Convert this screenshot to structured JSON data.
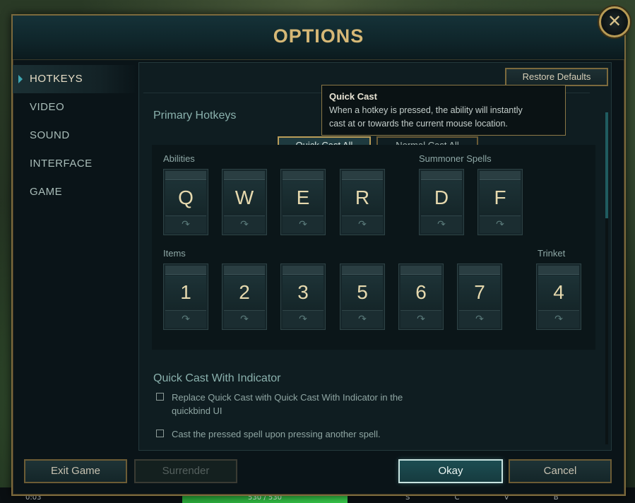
{
  "window": {
    "title": "OPTIONS"
  },
  "sidebar": {
    "items": [
      {
        "label": "HOTKEYS",
        "active": true
      },
      {
        "label": "VIDEO"
      },
      {
        "label": "SOUND"
      },
      {
        "label": "INTERFACE"
      },
      {
        "label": "GAME"
      }
    ]
  },
  "toolbar": {
    "restore_label": "Restore Defaults"
  },
  "primary": {
    "title": "Primary Hotkeys",
    "quick_cast_all": "Quick Cast All",
    "normal_cast_all": "Normal Cast All",
    "abilities_label": "Abilities",
    "summoner_label": "Summoner Spells",
    "items_label": "Items",
    "trinket_label": "Trinket",
    "abilities": [
      "Q",
      "W",
      "E",
      "R"
    ],
    "summoner": [
      "D",
      "F"
    ],
    "items": [
      "1",
      "2",
      "3",
      "5",
      "6",
      "7"
    ],
    "trinket": [
      "4"
    ]
  },
  "tooltip": {
    "title": "Quick Cast",
    "line1": "When a hotkey is pressed, the ability will instantly",
    "line2": "cast at or towards the current mouse location."
  },
  "indicator": {
    "title": "Quick Cast With Indicator",
    "option1_line1": "Replace Quick Cast with Quick Cast With Indicator in the",
    "option1_line2": "quickbind UI",
    "option2": "Cast the pressed spell upon pressing another spell."
  },
  "footer": {
    "exit": "Exit Game",
    "surrender": "Surrender",
    "okay": "Okay",
    "cancel": "Cancel"
  },
  "hud": {
    "health": "530 / 530",
    "left": "0:03",
    "right": "S C V B"
  },
  "colors": {
    "accent_gold": "#b99c58",
    "accent_teal": "#3fa7b3"
  }
}
